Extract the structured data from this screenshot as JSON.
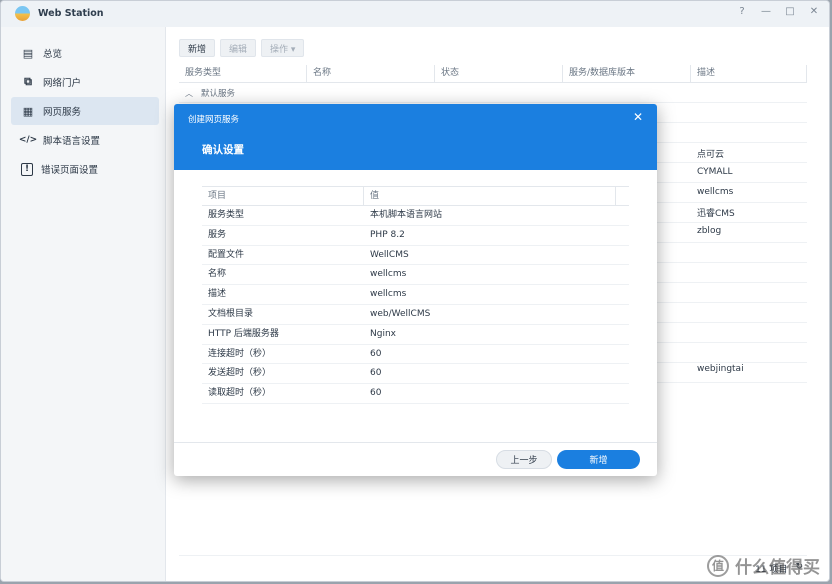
{
  "titlebar": {
    "app_title": "Web Station",
    "help": "?",
    "minimize": "—",
    "maximize": "□",
    "close": "✕"
  },
  "sidebar": {
    "items": [
      {
        "label": "总览",
        "icon": "overview-icon",
        "glyph": "▤"
      },
      {
        "label": "网络门户",
        "icon": "portal-icon",
        "glyph": "⧉"
      },
      {
        "label": "网页服务",
        "icon": "grid-icon",
        "glyph": "▦"
      },
      {
        "label": "脚本语言设置",
        "icon": "code-icon",
        "glyph": "</>"
      },
      {
        "label": "错误页面设置",
        "icon": "error-page-icon",
        "glyph": "!"
      }
    ]
  },
  "toolbar": {
    "new_label": "新增",
    "edit_label": "编辑",
    "action_label": "操作 ▾"
  },
  "table": {
    "headers": [
      "服务类型",
      "名称",
      "状态",
      "服务/数据库版本",
      "描述"
    ],
    "group_label": "默认服务",
    "descriptions": [
      "点可云",
      "CYMALL",
      "wellcms",
      "迅睿CMS",
      "zblog",
      "webjingtai"
    ]
  },
  "status": {
    "count": "11 项目",
    "refresh_icon": "refresh-icon"
  },
  "dialog": {
    "caption": "创建网页服务",
    "close": "✕",
    "subtitle": "确认设置",
    "col_item": "项目",
    "col_value": "值",
    "rows": [
      {
        "k": "服务类型",
        "v": "本机脚本语言网站"
      },
      {
        "k": "服务",
        "v": "PHP 8.2"
      },
      {
        "k": "配置文件",
        "v": "WellCMS"
      },
      {
        "k": "名称",
        "v": "wellcms"
      },
      {
        "k": "描述",
        "v": "wellcms"
      },
      {
        "k": "文档根目录",
        "v": "web/WellCMS"
      },
      {
        "k": "HTTP 后端服务器",
        "v": "Nginx"
      },
      {
        "k": "连接超时（秒）",
        "v": "60"
      },
      {
        "k": "发送超时（秒）",
        "v": "60"
      },
      {
        "k": "读取超时（秒）",
        "v": "60"
      }
    ],
    "prev_label": "上一步",
    "new_label": "新增"
  },
  "watermark": {
    "badge": "值",
    "text": "什么值得买"
  }
}
